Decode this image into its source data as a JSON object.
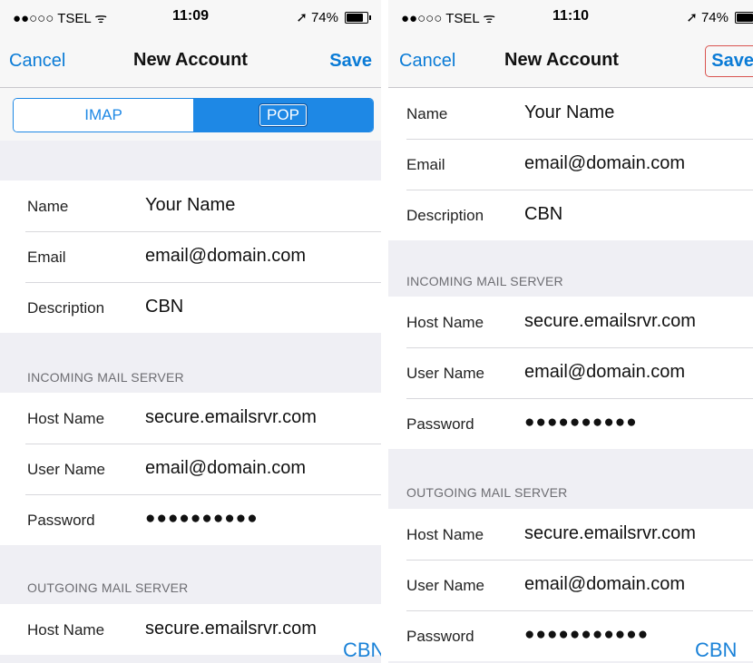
{
  "left": {
    "status": {
      "carrier": "●●○○○ TSEL ᯤ",
      "time": "11:09",
      "battery": "74%",
      "battery_level": 0.74
    },
    "nav": {
      "cancel": "Cancel",
      "title": "New Account",
      "save": "Save"
    },
    "segments": {
      "imap": "IMAP",
      "pop": "POP"
    },
    "account": [
      {
        "label": "Name",
        "value": "Your Name"
      },
      {
        "label": "Email",
        "value": "email@domain.com"
      },
      {
        "label": "Description",
        "value": "CBN"
      }
    ],
    "incoming_header": "INCOMING MAIL SERVER",
    "incoming": [
      {
        "label": "Host Name",
        "value": "secure.emailsrvr.com"
      },
      {
        "label": "User Name",
        "value": "email@domain.com"
      },
      {
        "label": "Password",
        "value": "●●●●●●●●●●"
      }
    ],
    "outgoing_header": "OUTGOING MAIL SERVER",
    "outgoing": [
      {
        "label": "Host Name",
        "value": "secure.emailsrvr.com"
      }
    ],
    "watermark": "CBN"
  },
  "right": {
    "status": {
      "carrier": "●●○○○ TSEL ᯤ",
      "time": "11:10",
      "battery": "74%",
      "battery_level": 0.74
    },
    "nav": {
      "cancel": "Cancel",
      "title": "New Account",
      "save": "Save"
    },
    "account": [
      {
        "label": "Name",
        "value": "Your Name"
      },
      {
        "label": "Email",
        "value": "email@domain.com"
      },
      {
        "label": "Description",
        "value": "CBN"
      }
    ],
    "incoming_header": "INCOMING MAIL SERVER",
    "incoming": [
      {
        "label": "Host Name",
        "value": "secure.emailsrvr.com"
      },
      {
        "label": "User Name",
        "value": "email@domain.com"
      },
      {
        "label": "Password",
        "value": "●●●●●●●●●●"
      }
    ],
    "outgoing_header": "OUTGOING MAIL SERVER",
    "outgoing": [
      {
        "label": "Host Name",
        "value": "secure.emailsrvr.com"
      },
      {
        "label": "User Name",
        "value": "email@domain.com"
      },
      {
        "label": "Password",
        "value": "●●●●●●●●●●●"
      }
    ],
    "watermark": "CBN"
  },
  "colors": {
    "accent": "#1e88e5",
    "link": "#0a7bd6",
    "watermark": "#1a82d8"
  },
  "icons": {
    "signal": "signal-dots-icon",
    "wifi": "wifi-icon",
    "location": "location-arrow-icon",
    "battery": "battery-icon"
  }
}
